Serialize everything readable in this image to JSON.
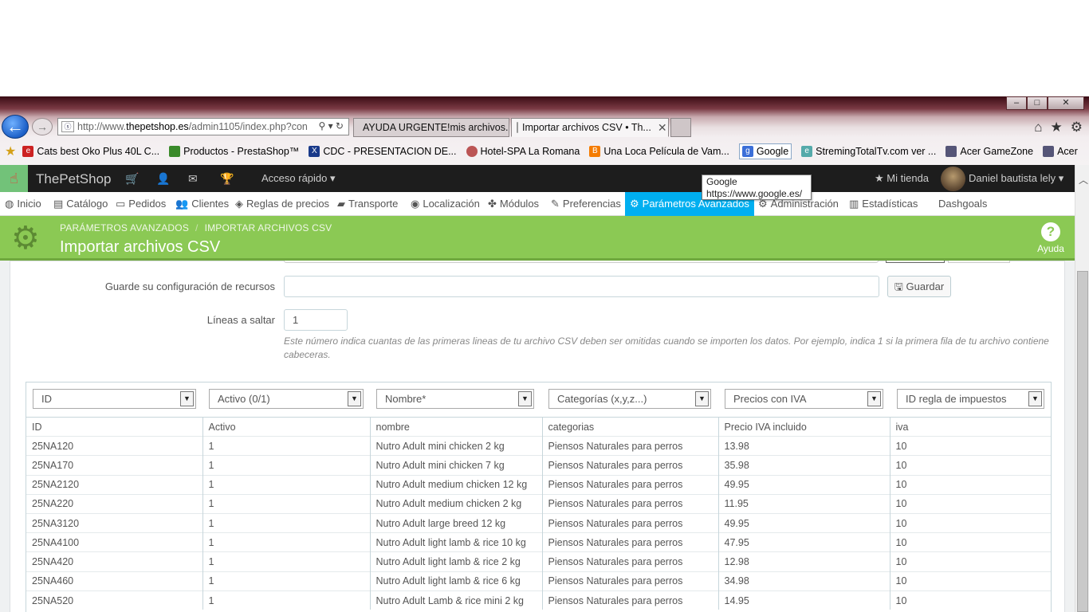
{
  "browser": {
    "window_controls": [
      "–",
      "□",
      "✕"
    ],
    "url_prefix": "http://www.",
    "url_host": "thepetshop.es",
    "url_rest": "/admin1105/index.php?con",
    "tabs": [
      {
        "label": "AYUDA URGENTE!mis archivos...",
        "active": false
      },
      {
        "label": "Importar archivos CSV • Th...",
        "active": true
      }
    ],
    "favorites": [
      {
        "label": "Cats best Oko Plus 40L  C...",
        "color": "#c22"
      },
      {
        "label": "Productos - PrestaShop™",
        "color": "#3a8a2a"
      },
      {
        "label": "CDC - PRESENTACION DE...",
        "color": "#1a3a8a"
      },
      {
        "label": "Hotel-SPA La Romana",
        "color": "#b55"
      },
      {
        "label": "Una Loca Película de Vam...",
        "color": "#f57c00"
      },
      {
        "label": "Google",
        "color": "#3b6fd8"
      },
      {
        "label": "StremingTotalTv.com ver ...",
        "color": "#5aa"
      },
      {
        "label": "Acer GameZone",
        "color": "#557"
      },
      {
        "label": "Acer",
        "color": "#557"
      }
    ]
  },
  "tooltip": {
    "title": "Google",
    "url": "https://www.google.es/"
  },
  "admin": {
    "shop_name": "ThePetShop",
    "quick_access": "Acceso rápido ▾",
    "my_shop": "Mi tienda",
    "user": "Daniel bautista lely ▾"
  },
  "menu": [
    {
      "label": "Inicio",
      "icon": "🎨"
    },
    {
      "label": "Catálogo",
      "icon": "📖"
    },
    {
      "label": "Pedidos",
      "icon": "💳"
    },
    {
      "label": "Clientes",
      "icon": "👥"
    },
    {
      "label": "Reglas de precios",
      "icon": "🏷"
    },
    {
      "label": "Transporte",
      "icon": "🚚"
    },
    {
      "label": "Localización",
      "icon": "🌐"
    },
    {
      "label": "Módulos",
      "icon": "🧩"
    },
    {
      "label": "Preferencias",
      "icon": "🔧"
    },
    {
      "label": "Parámetros Avanzados",
      "icon": "⚙"
    },
    {
      "label": "Administración",
      "icon": "⚙"
    },
    {
      "label": "Estadísticas",
      "icon": "📊"
    },
    {
      "label": "Dashgoals",
      "icon": ""
    }
  ],
  "page": {
    "breadcrumb_1": "PARÁMETROS AVANZADOS",
    "breadcrumb_2": "IMPORTAR ARCHIVOS CSV",
    "title": "Importar archivos CSV",
    "help_label": "Ayuda"
  },
  "form": {
    "save_config_label": "Guarde su configuración de recursos",
    "save_config_value": "",
    "save_button": "Guardar",
    "skip_lines_label": "Líneas a saltar",
    "skip_lines_value": "1",
    "hint": "Este número indica cuantas de las primeras lineas de tu archivo CSV deben ser omitidas cuando se importen los datos. Por ejemplo, indica 1 si la primera fila de tu archivo contiene cabeceras."
  },
  "mapping_selects": [
    "ID",
    "Activo (0/1)",
    "Nombre*",
    "Categorías (x,y,z...)",
    "Precios con IVA",
    "ID regla de impuestos"
  ],
  "table": {
    "headers": [
      "ID",
      "Activo",
      "nombre",
      "categorias",
      "Precio IVA incluido",
      "iva"
    ],
    "rows": [
      [
        "25NA120",
        "1",
        "Nutro Adult mini chicken 2 kg",
        "Piensos Naturales para perros",
        "13.98",
        "10"
      ],
      [
        "25NA170",
        "1",
        "Nutro Adult mini chicken 7 kg",
        "Piensos Naturales para perros",
        "35.98",
        "10"
      ],
      [
        "25NA2120",
        "1",
        "Nutro Adult medium chicken 12 kg",
        "Piensos Naturales para perros",
        "49.95",
        "10"
      ],
      [
        "25NA220",
        "1",
        "Nutro Adult medium chicken 2 kg",
        "Piensos Naturales para perros",
        "11.95",
        "10"
      ],
      [
        "25NA3120",
        "1",
        "Nutro Adult large breed 12 kg",
        "Piensos Naturales para perros",
        "49.95",
        "10"
      ],
      [
        "25NA4100",
        "1",
        "Nutro Adult light lamb & rice 10 kg",
        "Piensos Naturales para perros",
        "47.95",
        "10"
      ],
      [
        "25NA420",
        "1",
        "Nutro Adult light lamb & rice 2 kg",
        "Piensos Naturales para perros",
        "12.98",
        "10"
      ],
      [
        "25NA460",
        "1",
        "Nutro Adult light lamb & rice 6 kg",
        "Piensos Naturales para perros",
        "34.98",
        "10"
      ],
      [
        "25NA520",
        "1",
        "Nutro Adult Lamb & rice mini 2 kg",
        "Piensos Naturales para perros",
        "14.95",
        "10"
      ]
    ]
  },
  "colors": {
    "admin_green": "#8bc954",
    "active_menu": "#00aff0",
    "dark_bar": "#1d1d1d"
  }
}
